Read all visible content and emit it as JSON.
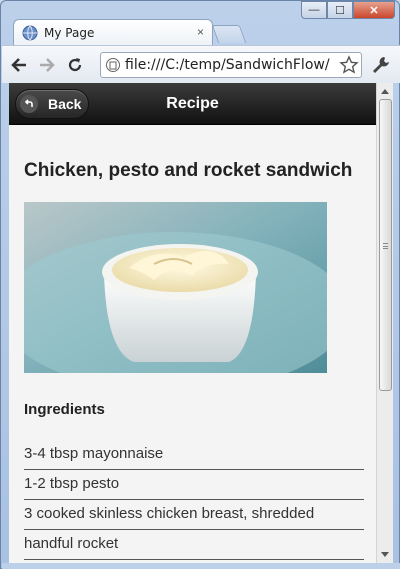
{
  "browser": {
    "tab_title": "My Page",
    "tab_close": "×",
    "url": "file:///C:/temp/SandwichFlow/",
    "window_buttons": {
      "minimize": "—",
      "maximize": "☐",
      "close": "✕"
    }
  },
  "header": {
    "back_label": "Back",
    "title": "Recipe"
  },
  "recipe": {
    "title": "Chicken, pesto and rocket sandwich",
    "photo_subject": "bowl of mayonnaise",
    "ingredients_heading": "Ingredients",
    "ingredients": [
      "3-4 tbsp mayonnaise",
      "1-2 tbsp pesto",
      "3 cooked skinless chicken breast, shredded",
      "handful rocket"
    ]
  },
  "colors": {
    "header_bg": "#1c1c1c",
    "page_bg": "#f4f4f4",
    "frame": "#bcd0ea"
  }
}
